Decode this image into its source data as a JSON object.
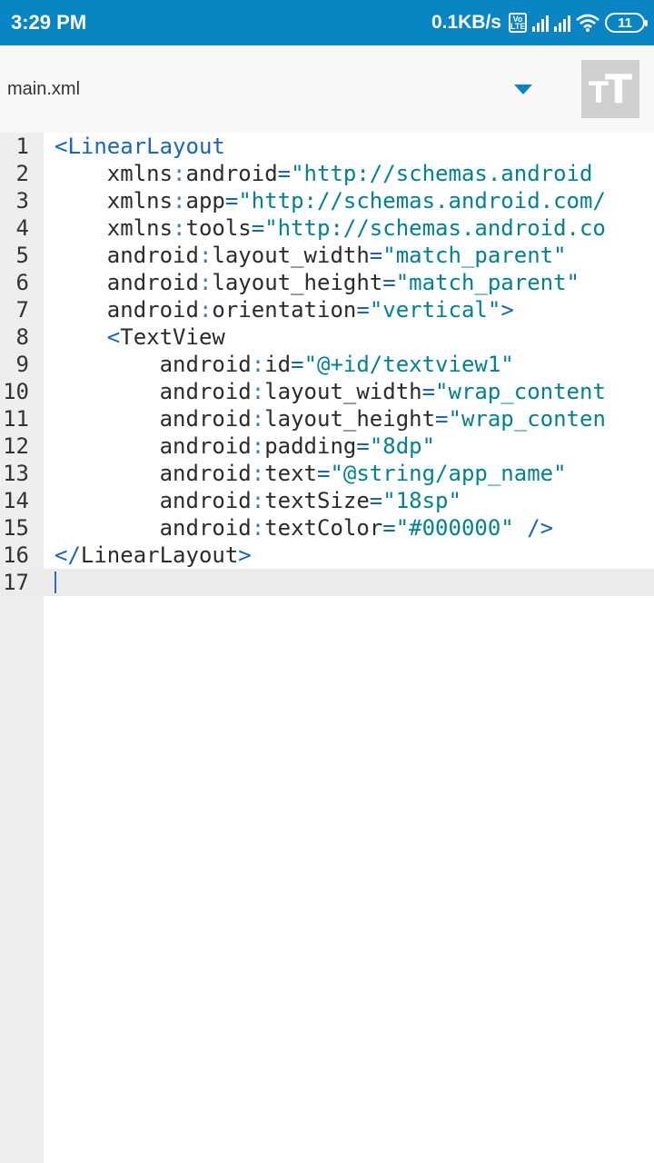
{
  "status_bar": {
    "time": "3:29 PM",
    "net_speed": "0.1KB/s",
    "volte": "Vo LTE",
    "battery": "11",
    "icons": [
      "volte-icon",
      "signal-icon",
      "signal-icon",
      "wifi-icon",
      "battery-icon"
    ]
  },
  "toolbar": {
    "file_name": "main.xml",
    "dropdown_icon": "dropdown-arrow-icon",
    "text_tool_icon": "text-size-icon"
  },
  "colors": {
    "status_bar": "#0a85c4",
    "accent": "#0a85c4",
    "tag": "#1565c0",
    "value": "#00838f"
  },
  "editor": {
    "current_line": "17",
    "lines": [
      {
        "n": "1",
        "parts": [
          [
            "tag",
            "<LinearLayout"
          ]
        ]
      },
      {
        "n": "2",
        "parts": [
          [
            "attr",
            "    xmlns"
          ],
          [
            "colon",
            ":"
          ],
          [
            "attr",
            "android"
          ],
          [
            "eq",
            "="
          ],
          [
            "val",
            "\"http://schemas.android"
          ]
        ]
      },
      {
        "n": "3",
        "parts": [
          [
            "attr",
            "    xmlns"
          ],
          [
            "colon",
            ":"
          ],
          [
            "attr",
            "app"
          ],
          [
            "eq",
            "="
          ],
          [
            "val",
            "\"http://schemas.android.com/"
          ]
        ]
      },
      {
        "n": "4",
        "parts": [
          [
            "attr",
            "    xmlns"
          ],
          [
            "colon",
            ":"
          ],
          [
            "attr",
            "tools"
          ],
          [
            "eq",
            "="
          ],
          [
            "val",
            "\"http://schemas.android.co"
          ]
        ]
      },
      {
        "n": "5",
        "parts": [
          [
            "attr",
            "    android"
          ],
          [
            "colon",
            ":"
          ],
          [
            "attr",
            "layout_width"
          ],
          [
            "eq",
            "="
          ],
          [
            "val",
            "\"match_parent\""
          ]
        ]
      },
      {
        "n": "6",
        "parts": [
          [
            "attr",
            "    android"
          ],
          [
            "colon",
            ":"
          ],
          [
            "attr",
            "layout_height"
          ],
          [
            "eq",
            "="
          ],
          [
            "val",
            "\"match_parent\""
          ]
        ]
      },
      {
        "n": "7",
        "parts": [
          [
            "attr",
            "    android"
          ],
          [
            "colon",
            ":"
          ],
          [
            "attr",
            "orientation"
          ],
          [
            "eq",
            "="
          ],
          [
            "val",
            "\"vertical\""
          ],
          [
            "tag",
            ">"
          ]
        ]
      },
      {
        "n": "8",
        "parts": [
          [
            "tag",
            "    <"
          ],
          [
            "attr",
            "TextView"
          ]
        ]
      },
      {
        "n": "9",
        "parts": [
          [
            "attr",
            "        android"
          ],
          [
            "colon",
            ":"
          ],
          [
            "attr",
            "id"
          ],
          [
            "eq",
            "="
          ],
          [
            "val",
            "\"@+id/textview1\""
          ]
        ]
      },
      {
        "n": "10",
        "parts": [
          [
            "attr",
            "        android"
          ],
          [
            "colon",
            ":"
          ],
          [
            "attr",
            "layout_width"
          ],
          [
            "eq",
            "="
          ],
          [
            "val",
            "\"wrap_content"
          ]
        ]
      },
      {
        "n": "11",
        "parts": [
          [
            "attr",
            "        android"
          ],
          [
            "colon",
            ":"
          ],
          [
            "attr",
            "layout_height"
          ],
          [
            "eq",
            "="
          ],
          [
            "val",
            "\"wrap_conten"
          ]
        ]
      },
      {
        "n": "12",
        "parts": [
          [
            "attr",
            "        android"
          ],
          [
            "colon",
            ":"
          ],
          [
            "attr",
            "padding"
          ],
          [
            "eq",
            "="
          ],
          [
            "val",
            "\"8dp\""
          ]
        ]
      },
      {
        "n": "13",
        "parts": [
          [
            "attr",
            "        android"
          ],
          [
            "colon",
            ":"
          ],
          [
            "attr",
            "text"
          ],
          [
            "eq",
            "="
          ],
          [
            "val",
            "\"@string/app_name\""
          ]
        ]
      },
      {
        "n": "14",
        "parts": [
          [
            "attr",
            "        android"
          ],
          [
            "colon",
            ":"
          ],
          [
            "attr",
            "textSize"
          ],
          [
            "eq",
            "="
          ],
          [
            "val",
            "\"18sp\""
          ]
        ]
      },
      {
        "n": "15",
        "parts": [
          [
            "attr",
            "        android"
          ],
          [
            "colon",
            ":"
          ],
          [
            "attr",
            "textColor"
          ],
          [
            "eq",
            "="
          ],
          [
            "val",
            "\"#000000\""
          ],
          [
            "tag",
            " />"
          ]
        ]
      },
      {
        "n": "16",
        "parts": [
          [
            "tag",
            "</"
          ],
          [
            "attr",
            "LinearLayout"
          ],
          [
            "tag",
            ">"
          ]
        ]
      },
      {
        "n": "17",
        "parts": []
      }
    ]
  }
}
